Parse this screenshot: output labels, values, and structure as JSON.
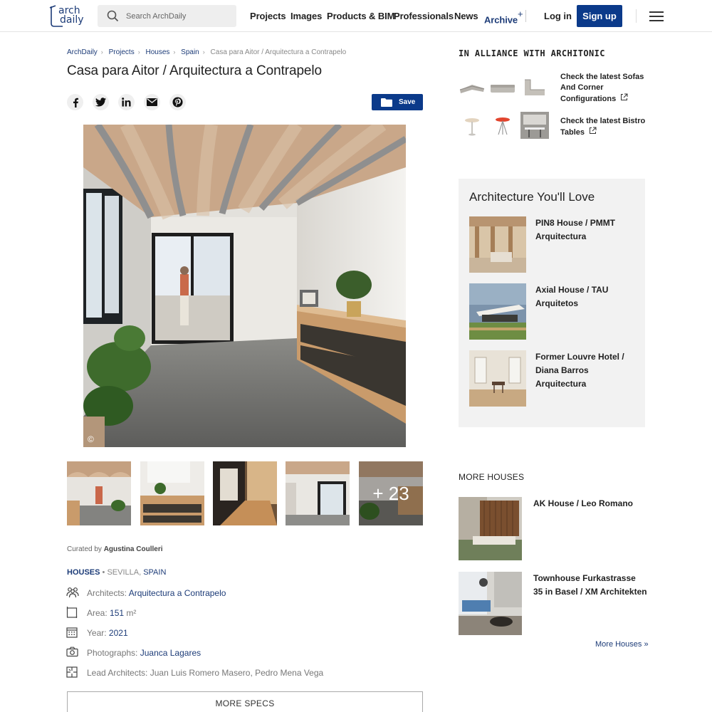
{
  "header": {
    "logo_text_1": "arch",
    "logo_text_2": "daily",
    "search_placeholder": "Search ArchDaily",
    "nav": [
      "Projects",
      "Images",
      "Products & BIM",
      "Professionals",
      "News",
      "Archive"
    ],
    "archive_plus": "+",
    "login": "Log in",
    "signup": "Sign up"
  },
  "breadcrumb": [
    "ArchDaily",
    "Projects",
    "Houses",
    "Spain",
    "Casa para Aitor / Arquitectura a Contrapelo"
  ],
  "title": "Casa para Aitor / Arquitectura a Contrapelo",
  "share": {
    "icons": [
      "facebook-icon",
      "twitter-icon",
      "linkedin-icon",
      "mail-icon",
      "pinterest-icon"
    ],
    "save_label": "Save"
  },
  "hero": {
    "copyright": "©"
  },
  "thumbs": {
    "more_label": "+ 23"
  },
  "curated": {
    "prefix": "Curated by ",
    "name": "Agustina Coulleri"
  },
  "category": {
    "type": "HOUSES",
    "dot": " • ",
    "city": "SEVILLA, ",
    "country": "SPAIN"
  },
  "specs": {
    "architects_label": "Architects: ",
    "architects_value": "Arquitectura a Contrapelo",
    "area_label": "Area: ",
    "area_value": "151",
    "area_unit": " m²",
    "year_label": "Year: ",
    "year_value": "2021",
    "photographs_label": "Photographs: ",
    "photographs_value": "Juanca Lagares",
    "lead_label": "Lead Architects: ",
    "lead_value": "Juan Luis Romero Masero, Pedro Mena Vega"
  },
  "more_specs": "MORE SPECS",
  "alliance": {
    "title": "IN ALLIANCE WITH ARCHITONIC",
    "link1": "Check the latest Sofas And Corner Configurations",
    "link2": "Check the latest Bistro Tables"
  },
  "love": {
    "title": "Architecture You'll Love",
    "items": [
      "PIN8 House / PMMT Arquitectura",
      "Axial House / TAU Arquitetos",
      "Former Louvre Hotel / Diana Barros Arquitectura"
    ]
  },
  "more_houses": {
    "title": "MORE HOUSES",
    "items": [
      "AK House / Leo Romano",
      "Townhouse Furkastrasse 35 in Basel / XM Architekten"
    ],
    "link": "More Houses »"
  },
  "colors": {
    "brand": "#0b3a8a",
    "link": "#1d3c78"
  }
}
